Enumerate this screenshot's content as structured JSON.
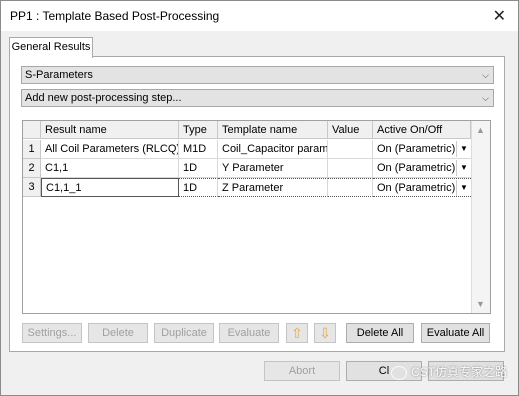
{
  "window": {
    "title": "PP1 : Template Based Post-Processing",
    "close_glyph": "✕"
  },
  "tabs": [
    {
      "label": "General Results",
      "active": true
    }
  ],
  "result_type_combo": {
    "value": "S-Parameters"
  },
  "step_combo": {
    "value": "Add new post-processing step..."
  },
  "table": {
    "columns": [
      "Result name",
      "Type",
      "Template name",
      "Value",
      "Active On/Off"
    ],
    "rows": [
      {
        "num": "1",
        "result_name": "All Coil Parameters (RLCQ)",
        "type": "M1D",
        "template": "Coil_Capacitor paramet",
        "value": "",
        "active": "On (Parametric)"
      },
      {
        "num": "2",
        "result_name": "C1,1",
        "type": "1D",
        "template": "Y Parameter",
        "value": "",
        "active": "On (Parametric)"
      },
      {
        "num": "3",
        "result_name": "C1,1_1",
        "type": "1D",
        "template": "Z Parameter",
        "value": "",
        "active": "On (Parametric)"
      }
    ]
  },
  "buttons": {
    "settings": "Settings...",
    "delete": "Delete",
    "duplicate": "Duplicate",
    "evaluate": "Evaluate",
    "delete_all": "Delete All",
    "evaluate_all": "Evaluate All",
    "abort": "Abort",
    "close": "Cl"
  },
  "watermark": "CST仿真专家之路",
  "colors": {
    "arrow_accent": "#e3a840",
    "panel_bg": "#ffffff",
    "window_bg": "#f0f0f0"
  }
}
